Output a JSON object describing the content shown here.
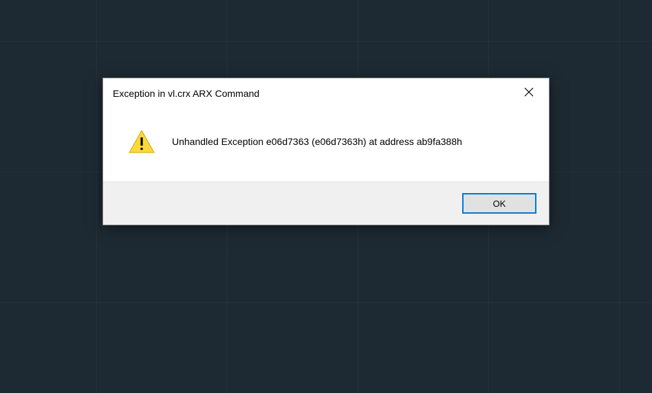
{
  "dialog": {
    "title": "Exception in vl.crx ARX Command",
    "message": "Unhandled Exception e06d7363 (e06d7363h) at address ab9fa388h",
    "ok_label": "OK"
  }
}
